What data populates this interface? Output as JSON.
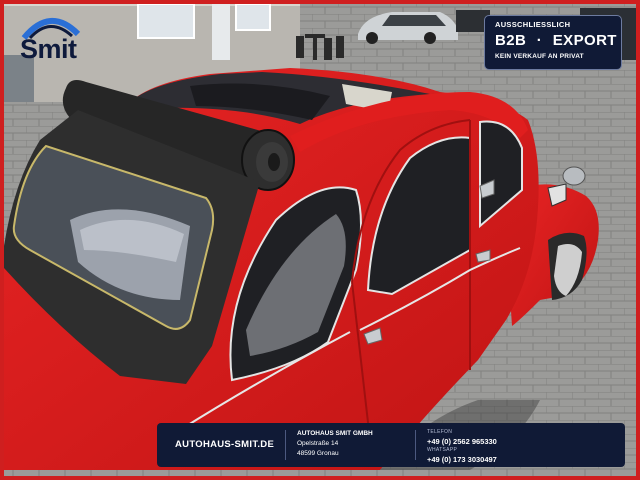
{
  "logo": {
    "wordmark": "Smit",
    "accent_color": "#2a6fd6",
    "text_color": "#0e1a3c"
  },
  "badge": {
    "top": "AUSSCHLIESSLICH",
    "main_left": "B2B",
    "main_sep": "·",
    "main_right": "EXPORT",
    "bottom": "KEIN VERKAUF AN PRIVAT"
  },
  "footer": {
    "website": "AUTOHAUS-SMIT.DE",
    "company_name": "AUTOHAUS SMIT GMBH",
    "street": "Opelstraße 14",
    "city": "48599 Gronau",
    "phone_label": "TELEFON",
    "phone": "+49 (0) 2562 965330",
    "whatsapp_label": "WHATSAPP",
    "whatsapp": "+49 (0) 173 3030497"
  },
  "colors": {
    "car_red": "#d81c1c",
    "frame_red": "#cf1f1f",
    "navy": "#101a36"
  }
}
